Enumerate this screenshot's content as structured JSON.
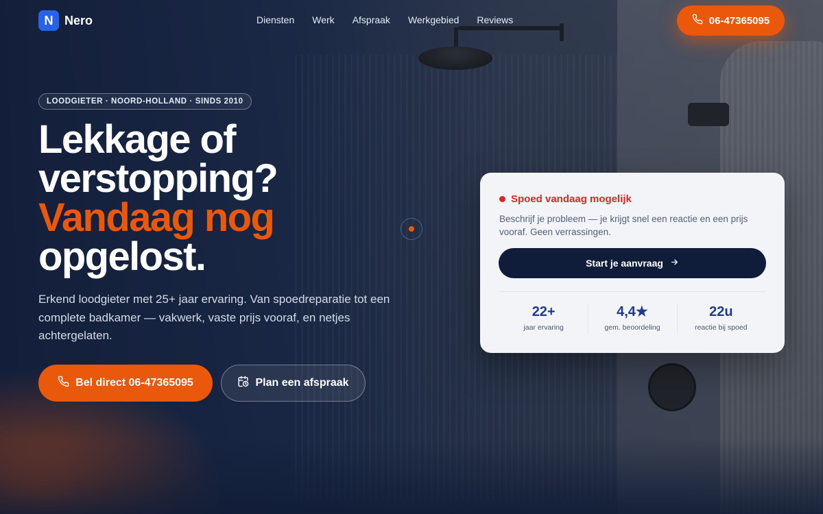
{
  "brand": {
    "logo_letter": "N",
    "name": "Nero"
  },
  "nav": {
    "items": [
      "Diensten",
      "Werk",
      "Afspraak",
      "Werkgebied",
      "Reviews"
    ]
  },
  "header": {
    "phone_label": "06-47365095",
    "phone_icon": "phone-icon"
  },
  "hero": {
    "badge": "LOODGIETER · NOORD-HOLLAND · SINDS 2010",
    "headline_line1": "Lekkage of",
    "headline_line2": "verstopping?",
    "headline_accent": "Vandaag nog",
    "headline_line4": "opgelost.",
    "lead": "Erkend loodgieter met 25+ jaar ervaring. Van spoedreparatie tot een complete badkamer — vakwerk, vaste prijs vooraf, en netjes achtergelaten.",
    "primary_button": "Bel direct 06-47365095",
    "secondary_button": "Plan een afspraak"
  },
  "card": {
    "status": "Spoed vandaag mogelijk",
    "description": "Beschrijf je probleem — je krijgt snel een reactie en een prijs vooraf. Geen verrassingen.",
    "cta": "Start je aanvraag",
    "stats": [
      {
        "value": "22+",
        "label": "jaar ervaring"
      },
      {
        "value": "4,4★",
        "label": "gem. beoordeling"
      },
      {
        "value": "22u",
        "label": "reactie bij spoed"
      }
    ]
  },
  "colors": {
    "accent": "#ea580c",
    "navy": "#0f1d3a",
    "brand_blue": "#2563eb",
    "status_red": "#dc2626"
  }
}
